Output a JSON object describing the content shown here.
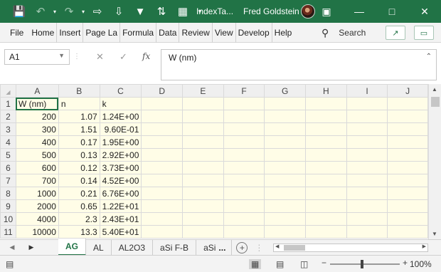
{
  "titlebar": {
    "title": "IndexTa...",
    "user": "Fred Goldstein",
    "icons": [
      "save-icon",
      "undo-icon",
      "redo-icon",
      "qat-icon-1",
      "qat-icon-2",
      "qat-icon-3",
      "qat-icon-4",
      "qat-icon-5",
      "customize-qat-icon"
    ]
  },
  "ribbon": {
    "tabs": [
      "File",
      "Home",
      "Insert",
      "Page La",
      "Formula",
      "Data",
      "Review",
      "View",
      "Develop",
      "Help"
    ],
    "search_label": "Search"
  },
  "formula": {
    "namebox": "A1",
    "fx_label": "fx",
    "content": "W (nm)"
  },
  "grid": {
    "columns": [
      "A",
      "B",
      "C",
      "D",
      "E",
      "F",
      "G",
      "H",
      "I",
      "J"
    ],
    "rows": [
      {
        "n": "1",
        "a": "W (nm)",
        "b": "n",
        "c": "k"
      },
      {
        "n": "2",
        "a": "200",
        "b": "1.07",
        "c": "1.24E+00"
      },
      {
        "n": "3",
        "a": "300",
        "b": "1.51",
        "c": "9.60E-01"
      },
      {
        "n": "4",
        "a": "400",
        "b": "0.17",
        "c": "1.95E+00"
      },
      {
        "n": "5",
        "a": "500",
        "b": "0.13",
        "c": "2.92E+00"
      },
      {
        "n": "6",
        "a": "600",
        "b": "0.12",
        "c": "3.73E+00"
      },
      {
        "n": "7",
        "a": "700",
        "b": "0.14",
        "c": "4.52E+00"
      },
      {
        "n": "8",
        "a": "1000",
        "b": "0.21",
        "c": "6.76E+00"
      },
      {
        "n": "9",
        "a": "2000",
        "b": "0.65",
        "c": "1.22E+01"
      },
      {
        "n": "10",
        "a": "4000",
        "b": "2.3",
        "c": "2.43E+01"
      },
      {
        "n": "11",
        "a": "10000",
        "b": "13.3",
        "c": "5.40E+01"
      }
    ]
  },
  "sheets": {
    "tabs": [
      "AG",
      "AL",
      "AL2O3",
      "aSi F-B",
      "aSi"
    ],
    "more": "...",
    "active": "AG"
  },
  "status": {
    "zoom": "100%",
    "zoom_minus": "−",
    "zoom_plus": "+"
  }
}
